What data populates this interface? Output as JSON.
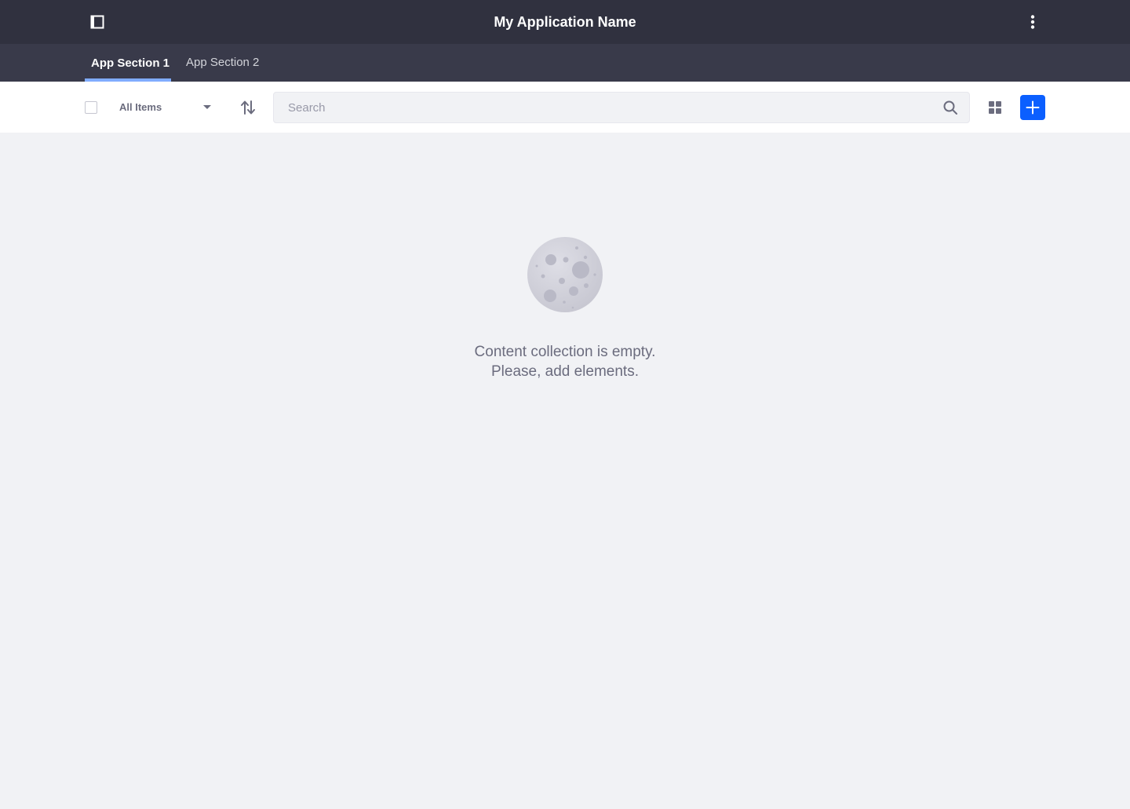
{
  "header": {
    "title": "My Application Name",
    "sidebar_toggle_icon": "sidebar-panel-icon",
    "menu_icon": "kebab-vertical-icon"
  },
  "tabs": [
    {
      "label": "App Section 1",
      "active": true
    },
    {
      "label": "App Section 2",
      "active": false
    }
  ],
  "toolbar": {
    "select_all_checked": false,
    "filter_label": "All Items",
    "sort_icon": "sort-arrows-icon",
    "search": {
      "placeholder": "Search",
      "value": ""
    },
    "view_icon": "grid-view-icon",
    "add_icon": "plus-icon"
  },
  "empty_state": {
    "icon": "moon-icon",
    "line1": "Content collection is empty.",
    "line2": "Please, add elements."
  },
  "colors": {
    "header_bg": "#30313f",
    "tabbar_bg": "#393a4a",
    "tab_active_indicator": "#80acff",
    "page_bg": "#f1f2f5",
    "primary": "#0b5fff",
    "muted_text": "#6b6c7e"
  }
}
